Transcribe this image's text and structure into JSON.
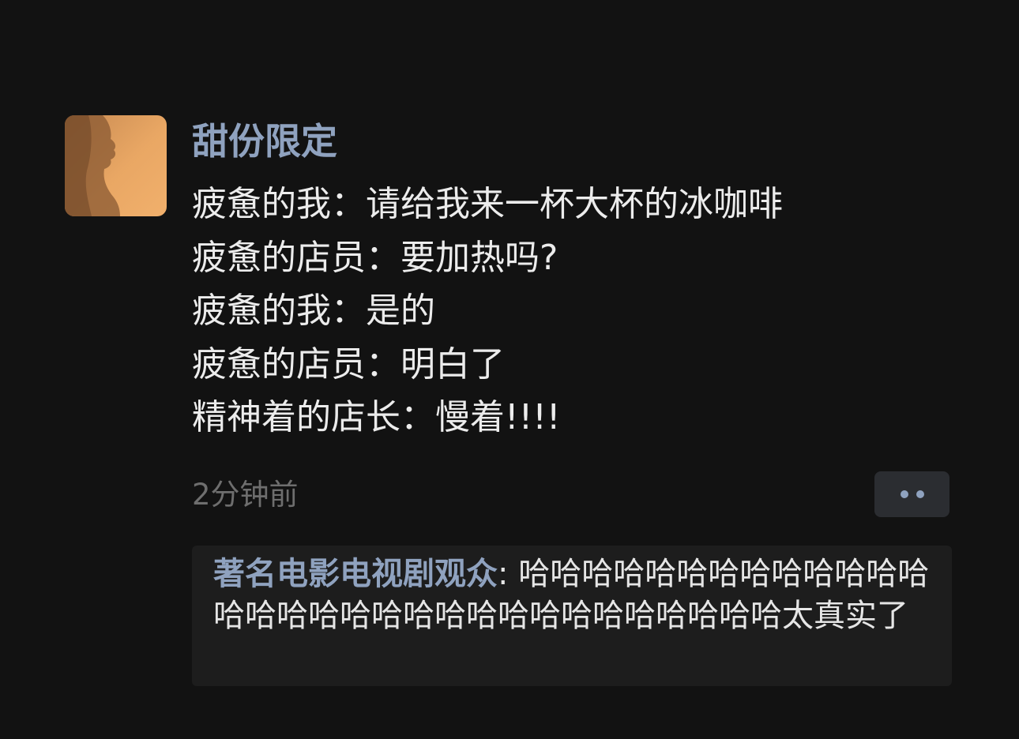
{
  "post": {
    "username": "甜份限定",
    "lines": [
      "疲惫的我：请给我来一杯大杯的冰咖啡",
      "疲惫的店员：要加热吗?",
      "疲惫的我：是的",
      "疲惫的店员：明白了",
      "精神着的店长：慢着!!!!"
    ],
    "timestamp": "2分钟前",
    "more_icon": "more-dots-icon"
  },
  "comment": {
    "author": "著名电影电视剧观众",
    "separator": ": ",
    "text": "哈哈哈哈哈哈哈哈哈哈哈哈哈哈哈哈哈哈哈哈哈哈哈哈哈哈哈哈哈哈哈太真实了"
  },
  "colors": {
    "background": "#121212",
    "username": "#8fa2bf",
    "text": "#ececec",
    "timestamp": "#6e6e6e",
    "comment_bg": "#1d1d1d",
    "button_bg": "#2b2d31"
  }
}
